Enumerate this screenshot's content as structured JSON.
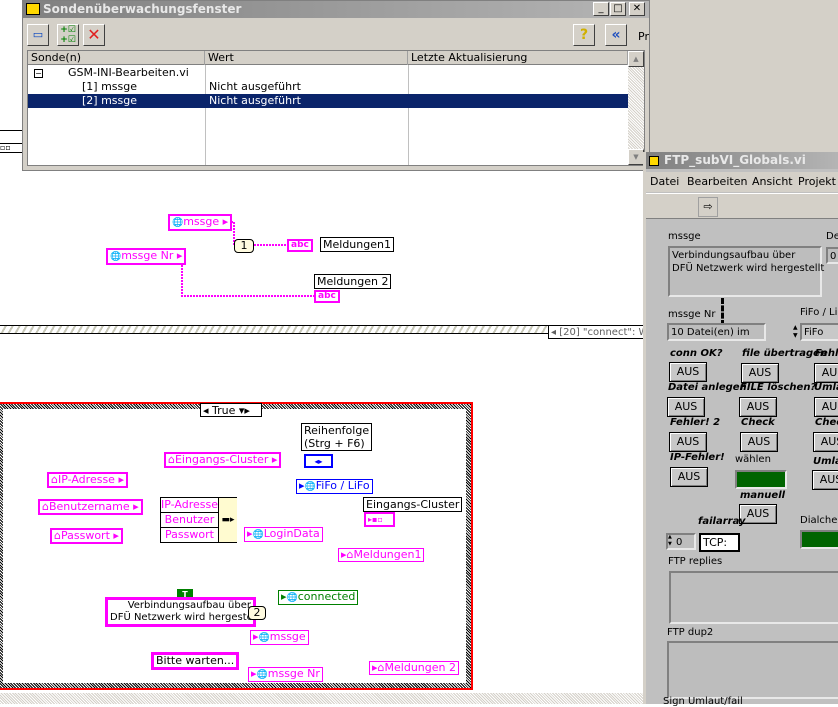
{
  "probe_window": {
    "title": "Sondenüberwachungsfenster",
    "toolbar": {
      "new_probe": "new-probe-icon",
      "add_probe": "add-probes-icon",
      "delete": "✕",
      "help": "?",
      "collapse": "«"
    },
    "columns": [
      "Sonde(n)",
      "Wert",
      "Letzte Aktualisierung"
    ],
    "rows": [
      {
        "sonde": "GSM-INI-Bearbeiten.vi",
        "wert": "",
        "letzte": "",
        "expand": "−"
      },
      {
        "sonde": "[1] mssge",
        "wert": "Nicht ausgeführt",
        "letzte": ""
      },
      {
        "sonde": "[2] mssge",
        "wert": "Nicht ausgeführt",
        "letzte": "",
        "selected": true
      }
    ],
    "side_text": "Pr"
  },
  "diagram": {
    "top": {
      "mssge": "mssge",
      "mssge_nr": "mssge Nr",
      "const_1": "1",
      "meldungen1_label": "Meldungen1",
      "meldungen2_label": "Meldungen  2",
      "abc": "abc"
    },
    "sequence_label": "[20] \"connect\": W",
    "case_selector": "True",
    "case": {
      "reihenfolge": "Reihenfolge\n(Strg + F6)",
      "fifo_lifo": "FiFo / LiFo",
      "eingangs_cluster_local": "Eingangs-Cluster",
      "ip_adresse": "IP-Adresse",
      "benutzername": "Benutzername",
      "passwort": "Passwort",
      "bundle": [
        "IP-Adresse",
        "Benutzer",
        "Passwort"
      ],
      "login_data": "LoginData",
      "eingangs_cluster_label": "Eingangs-Cluster",
      "meldungen1": "Meldungen1",
      "true_const": "T",
      "string_const": "Verbindungsaufbau über\nDFÜ Netzwerk wird hergestellt",
      "const_2": "2",
      "connected": "connected",
      "mssge": "mssge",
      "bitte_warten": "Bitte warten...",
      "mssge_nr": "mssge Nr",
      "meldungen2": "Meldungen  2"
    }
  },
  "globals_window": {
    "title": "FTP_subVI_Globals.vi",
    "menu": [
      "Datei",
      "Bearbeiten",
      "Ansicht",
      "Projekt"
    ],
    "run_icon": "⇨",
    "mssge_label": "mssge",
    "mssge_value": "Verbindungsaufbau über\nDFÜ Netzwerk wird hergestellt",
    "del_label": "Del",
    "del_value": "0",
    "mssge_nr_label": "mssge Nr",
    "mssge_nr_value": "10 Datei(en) im",
    "fifo_label": "FiFo / LiF",
    "fifo_value": "FiFo",
    "booleans": [
      {
        "label": "conn OK?",
        "value": "AUS"
      },
      {
        "label": "file übertragen",
        "value": "AUS"
      },
      {
        "label": "Fehle",
        "value": "AUS"
      },
      {
        "label": "Datei anlegen",
        "value": "AUS"
      },
      {
        "label": "FILE löschen?",
        "value": "AUS"
      },
      {
        "label": "Umlau",
        "value": "AUS"
      },
      {
        "label": "Fehler! 2",
        "value": "AUS"
      },
      {
        "label": "Check",
        "value": "AUS"
      },
      {
        "label": "Check",
        "value": "AUS"
      },
      {
        "label": "IP-Fehler!",
        "value": "AUS"
      },
      {
        "label": "Umlau",
        "value": "AUS"
      },
      {
        "label": "manuell",
        "value": "AUS"
      }
    ],
    "waehlen_label": "wählen",
    "failarray_label": "failarray",
    "failarray_index": "0",
    "failarray_value": "TCP:",
    "dialcheck_label": "Dialcheck",
    "ftp_replies_label": "FTP replies",
    "ftp_dup2_label": "FTP dup2",
    "sign_label": "Sign Umlaut/fail",
    "led_color": "#006400"
  }
}
